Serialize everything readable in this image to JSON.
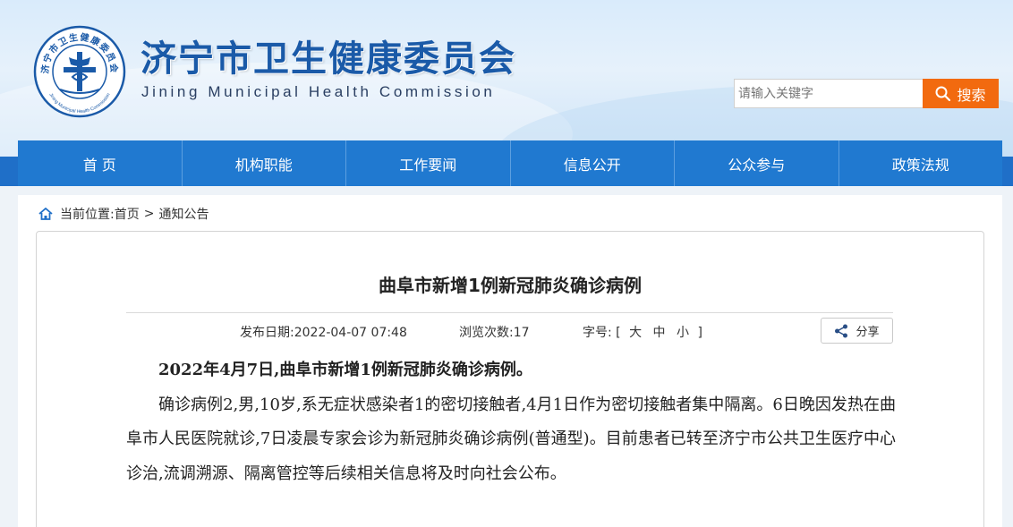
{
  "site": {
    "title": "济宁市卫生健康委员会",
    "subtitle": "Jining Municipal Health Commission",
    "emblem_top_text": "济宁市卫生健康委员会",
    "emblem_bottom_text": "Jining Municipal Health Commission"
  },
  "search": {
    "placeholder": "请输入关键字",
    "button_label": "搜索"
  },
  "nav": {
    "items": [
      {
        "label": "首 页"
      },
      {
        "label": "机构职能"
      },
      {
        "label": "工作要闻"
      },
      {
        "label": "信息公开"
      },
      {
        "label": "公众参与"
      },
      {
        "label": "政策法规"
      }
    ]
  },
  "breadcrumb": {
    "prefix": "当前位置:",
    "home": "首页",
    "separator": ">",
    "current": "通知公告"
  },
  "article": {
    "title": "曲阜市新增1例新冠肺炎确诊病例",
    "publish_label": "发布日期:",
    "publish_date": "2022-04-07 07:48",
    "views_label": "浏览次数:",
    "views": "17",
    "font_label": "字号:",
    "font_open": "[",
    "font_large": "大",
    "font_medium": "中",
    "font_small": "小",
    "font_close": "]",
    "share_label": "分享",
    "paragraphs": [
      "2022年4月7日,曲阜市新增1例新冠肺炎确诊病例。",
      "确诊病例2,男,10岁,系无症状感染者1的密切接触者,4月1日作为密切接触者集中隔离。6日晚因发热在曲阜市人民医院就诊,7日凌晨专家会诊为新冠肺炎确诊病例(普通型)。目前患者已转至济宁市公共卫生医疗中心诊治,流调溯源、隔离管控等后续相关信息将及时向社会公布。"
    ]
  },
  "colors": {
    "brand_blue": "#1a5aa8",
    "nav_blue": "#2079d0",
    "search_orange": "#f26a0f"
  },
  "icons": {
    "emblem": "health-commission-emblem",
    "search": "magnifier-icon",
    "home": "home-icon",
    "share": "share-icon"
  }
}
